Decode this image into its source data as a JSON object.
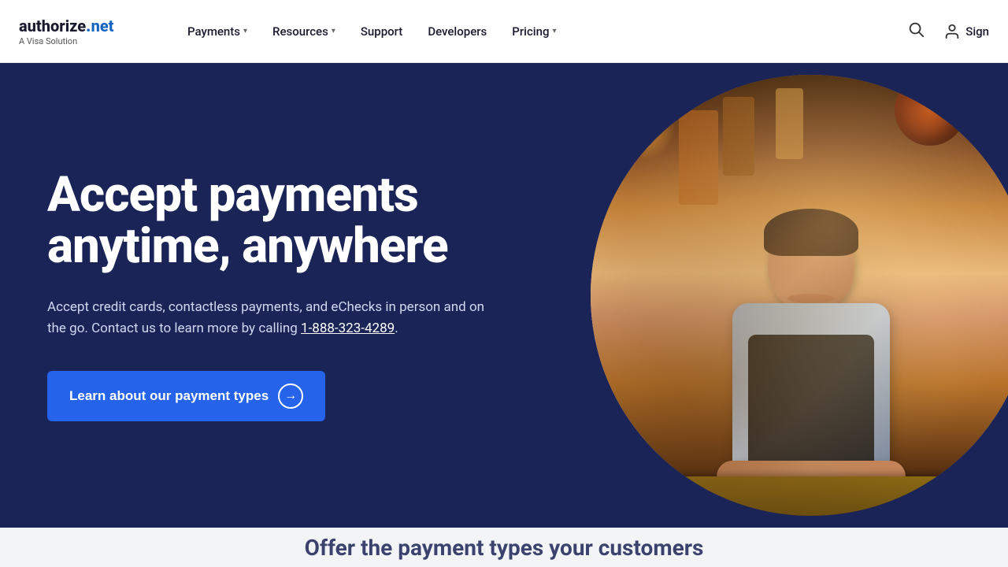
{
  "header": {
    "logo": {
      "brand": "authorize",
      "dot": ".",
      "net": "net",
      "tagline": "A Visa Solution"
    },
    "nav": [
      {
        "label": "Payments",
        "hasDropdown": true
      },
      {
        "label": "Resources",
        "hasDropdown": true
      },
      {
        "label": "Support",
        "hasDropdown": false
      },
      {
        "label": "Developers",
        "hasDropdown": false
      },
      {
        "label": "Pricing",
        "hasDropdown": true
      }
    ],
    "sign_in_label": "Sign"
  },
  "hero": {
    "title_line1": "Accept payments",
    "title_line2": "anytime, anywhere",
    "description_before_link": "Accept credit cards, contactless payments, and eChecks in person and on the go. Contact us to learn more by calling ",
    "phone_number": "1-888-323-4289",
    "description_after_link": ".",
    "cta_label": "Learn about our payment types"
  },
  "bottom_teaser": {
    "text": "Offer the payment types your customers"
  }
}
